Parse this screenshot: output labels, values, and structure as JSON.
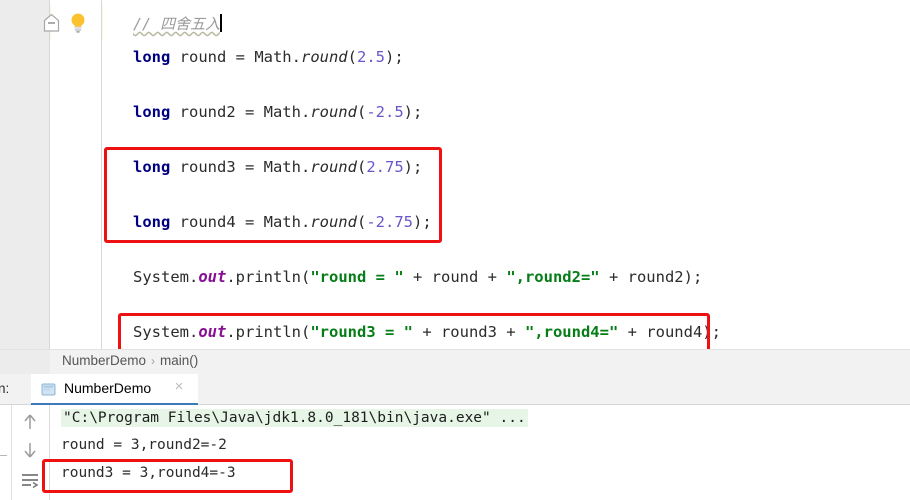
{
  "window": {
    "theme_background": "#ffffff",
    "accent_red": "#ee1111",
    "caret_line_color": "#fdf6e3"
  },
  "editor": {
    "name": "code-editor",
    "gutter_icons": {
      "fold_marker": "fold-collapse-icon",
      "intention_bulb": "lightbulb-icon"
    },
    "lines": [
      {
        "id": "line-comment",
        "type": "comment",
        "text": "// 四舍五入",
        "has_caret": true,
        "highlighted": true
      },
      {
        "id": "line-round",
        "type": "code",
        "tokens": [
          {
            "t": "long",
            "c": "kw"
          },
          {
            "t": " round = Math.",
            "c": "pln"
          },
          {
            "t": "round",
            "c": "mth"
          },
          {
            "t": "(",
            "c": "pln"
          },
          {
            "t": "2.5",
            "c": "num"
          },
          {
            "t": ");",
            "c": "pln"
          }
        ]
      },
      {
        "id": "line-round2",
        "type": "code",
        "tokens": [
          {
            "t": "long",
            "c": "kw"
          },
          {
            "t": " round2 = Math.",
            "c": "pln"
          },
          {
            "t": "round",
            "c": "mth"
          },
          {
            "t": "(",
            "c": "pln"
          },
          {
            "t": "-2.5",
            "c": "num"
          },
          {
            "t": ");",
            "c": "pln"
          }
        ]
      },
      {
        "id": "line-round3",
        "type": "code",
        "tokens": [
          {
            "t": "long",
            "c": "kw"
          },
          {
            "t": " round3 = Math.",
            "c": "pln"
          },
          {
            "t": "round",
            "c": "mth"
          },
          {
            "t": "(",
            "c": "pln"
          },
          {
            "t": "2.75",
            "c": "num"
          },
          {
            "t": ");",
            "c": "pln"
          }
        ]
      },
      {
        "id": "line-round4",
        "type": "code",
        "tokens": [
          {
            "t": "long",
            "c": "kw"
          },
          {
            "t": " round4 = Math.",
            "c": "pln"
          },
          {
            "t": "round",
            "c": "mth"
          },
          {
            "t": "(",
            "c": "pln"
          },
          {
            "t": "-2.75",
            "c": "num"
          },
          {
            "t": ");",
            "c": "pln"
          }
        ]
      },
      {
        "id": "line-print1",
        "type": "code",
        "tokens": [
          {
            "t": "System.",
            "c": "pln"
          },
          {
            "t": "out",
            "c": "fld"
          },
          {
            "t": ".println(",
            "c": "pln"
          },
          {
            "t": "\"round = \"",
            "c": "str"
          },
          {
            "t": " + round + ",
            "c": "pln"
          },
          {
            "t": "\",round2=\"",
            "c": "str"
          },
          {
            "t": " + round2);",
            "c": "pln"
          }
        ]
      },
      {
        "id": "line-print2",
        "type": "code",
        "tokens": [
          {
            "t": "System.",
            "c": "pln"
          },
          {
            "t": "out",
            "c": "fld"
          },
          {
            "t": ".println(",
            "c": "pln"
          },
          {
            "t": "\"round3 = \"",
            "c": "str"
          },
          {
            "t": " + round3 + ",
            "c": "pln"
          },
          {
            "t": "\",round4=\"",
            "c": "str"
          },
          {
            "t": " + round4);",
            "c": "pln"
          }
        ]
      }
    ],
    "annotations": [
      {
        "id": "redbox-declarations",
        "target": "round3 and round4 declarations"
      },
      {
        "id": "redbox-println",
        "target": "println of round3 and round4"
      }
    ]
  },
  "breadcrumb": {
    "items": [
      "NumberDemo",
      "main()"
    ],
    "separator": "›"
  },
  "run_panel": {
    "label": "n:",
    "full_label": "Run:",
    "tab": {
      "title": "NumberDemo",
      "icon": "run-config-icon",
      "close_label": "×"
    },
    "toolbar_icons": [
      "arrow-up-icon",
      "arrow-down-icon",
      "soft-wrap-icon"
    ],
    "console_lines": [
      {
        "id": "console-command",
        "text": "\"C:\\Program Files\\Java\\jdk1.8.0_181\\bin\\java.exe\" ...",
        "style": "command"
      },
      {
        "id": "console-out1",
        "text": "round = 3,round2=-2",
        "style": "stdout"
      },
      {
        "id": "console-out2",
        "text": "round3 = 3,round4=-3",
        "style": "stdout",
        "annotated": true
      }
    ]
  }
}
